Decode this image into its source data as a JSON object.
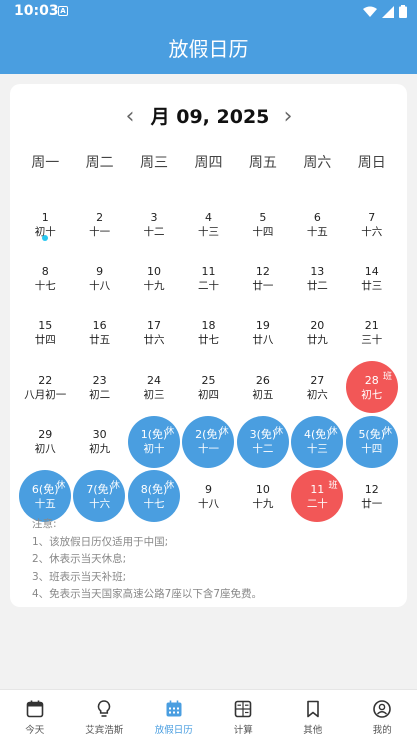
{
  "status": {
    "time": "10:03",
    "notif": "A"
  },
  "header": {
    "title": "放假日历"
  },
  "calendar": {
    "prev": "‹",
    "next": "›",
    "month_label": "月 09, 2025",
    "weekdays": [
      "周一",
      "周二",
      "周三",
      "周四",
      "周五",
      "周六",
      "周日"
    ],
    "cells": [
      {
        "day": "1",
        "lunar": "初十",
        "dot": true
      },
      {
        "day": "2",
        "lunar": "十一"
      },
      {
        "day": "3",
        "lunar": "十二"
      },
      {
        "day": "4",
        "lunar": "十三"
      },
      {
        "day": "5",
        "lunar": "十四"
      },
      {
        "day": "6",
        "lunar": "十五"
      },
      {
        "day": "7",
        "lunar": "十六"
      },
      {
        "day": "8",
        "lunar": "十七"
      },
      {
        "day": "9",
        "lunar": "十八"
      },
      {
        "day": "10",
        "lunar": "十九"
      },
      {
        "day": "11",
        "lunar": "二十"
      },
      {
        "day": "12",
        "lunar": "廿一"
      },
      {
        "day": "13",
        "lunar": "廿二"
      },
      {
        "day": "14",
        "lunar": "廿三"
      },
      {
        "day": "15",
        "lunar": "廿四"
      },
      {
        "day": "16",
        "lunar": "廿五"
      },
      {
        "day": "17",
        "lunar": "廿六"
      },
      {
        "day": "18",
        "lunar": "廿七"
      },
      {
        "day": "19",
        "lunar": "廿八"
      },
      {
        "day": "20",
        "lunar": "廿九"
      },
      {
        "day": "21",
        "lunar": "三十"
      },
      {
        "day": "22",
        "lunar": "八月初一"
      },
      {
        "day": "23",
        "lunar": "初二"
      },
      {
        "day": "24",
        "lunar": "初三"
      },
      {
        "day": "25",
        "lunar": "初四"
      },
      {
        "day": "26",
        "lunar": "初五"
      },
      {
        "day": "27",
        "lunar": "初六"
      },
      {
        "day": "28",
        "lunar": "初七",
        "type": "work",
        "tag": "班"
      },
      {
        "day": "29",
        "lunar": "初八"
      },
      {
        "day": "30",
        "lunar": "初九"
      },
      {
        "day": "1(免)",
        "lunar": "初十",
        "type": "holiday",
        "tag": "休"
      },
      {
        "day": "2(免)",
        "lunar": "十一",
        "type": "holiday",
        "tag": "休"
      },
      {
        "day": "3(免)",
        "lunar": "十二",
        "type": "holiday",
        "tag": "休"
      },
      {
        "day": "4(免)",
        "lunar": "十三",
        "type": "holiday",
        "tag": "休"
      },
      {
        "day": "5(免)",
        "lunar": "十四",
        "type": "holiday",
        "tag": "休"
      },
      {
        "day": "6(免)",
        "lunar": "十五",
        "type": "holiday",
        "tag": "休"
      },
      {
        "day": "7(免)",
        "lunar": "十六",
        "type": "holiday",
        "tag": "休"
      },
      {
        "day": "8(免)",
        "lunar": "十七",
        "type": "holiday",
        "tag": "休"
      },
      {
        "day": "9",
        "lunar": "十八"
      },
      {
        "day": "10",
        "lunar": "十九"
      },
      {
        "day": "11",
        "lunar": "二十",
        "type": "work",
        "tag": "班"
      },
      {
        "day": "12",
        "lunar": "廿一"
      }
    ]
  },
  "notes": {
    "title": "注意:",
    "lines": [
      "1、该放假日历仅适用于中国;",
      "2、休表示当天休息;",
      "3、班表示当天补班;",
      "4、免表示当天国家高速公路7座以下含7座免费。"
    ]
  },
  "tabs": [
    {
      "label": "今天",
      "icon": "calendar-day-icon"
    },
    {
      "label": "艾宾浩斯",
      "icon": "lightbulb-icon"
    },
    {
      "label": "放假日历",
      "icon": "calendar-grid-icon",
      "active": true
    },
    {
      "label": "计算",
      "icon": "calculator-icon"
    },
    {
      "label": "其他",
      "icon": "bookmark-icon"
    },
    {
      "label": "我的",
      "icon": "user-icon"
    }
  ],
  "colors": {
    "primary": "#4a9ee0",
    "work": "#f25757",
    "dot": "#29c7f0"
  }
}
